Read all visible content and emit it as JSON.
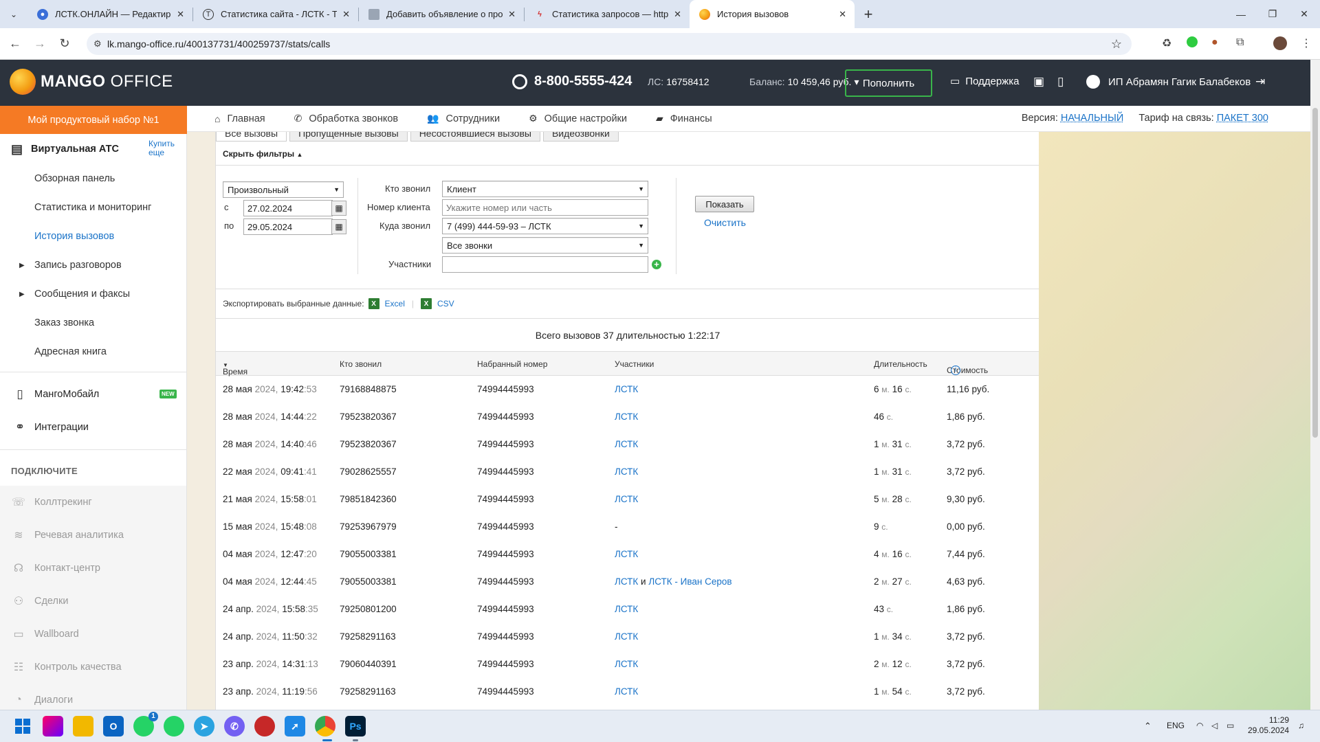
{
  "browser": {
    "tabs": [
      {
        "title": "ЛСТК.ОНЛАЙН — Редактиров",
        "icon": "chrome-profile-icon",
        "active": false
      },
      {
        "title": "Статистика сайта - ЛСТК - Tild",
        "icon": "tilda-icon",
        "active": false
      },
      {
        "title": "Добавить объявление о прод",
        "icon": "page-icon",
        "active": false
      },
      {
        "title": "Статистика запросов — https:",
        "icon": "wordstat-icon",
        "active": false
      },
      {
        "title": "История вызовов",
        "icon": "mango-icon",
        "active": true
      }
    ],
    "url": "lk.mango-office.ru/400137731/400259737/stats/calls"
  },
  "header": {
    "logo_bold": "MANGO",
    "logo_light": "OFFICE",
    "phone": "8-800-5555-424",
    "ls_label": "ЛС:",
    "ls_value": "16758412",
    "balance_label": "Баланс:",
    "balance_value": "10 459,46 руб.",
    "topup": "Пополнить",
    "support": "Поддержка",
    "user": "ИП Абрамян Гагик Балабеков"
  },
  "promo": "Мой продуктовый набор №1",
  "topnav": {
    "items": [
      "Главная",
      "Обработка звонков",
      "Сотрудники",
      "Общие настройки",
      "Финансы"
    ],
    "version_label": "Версия:",
    "version_value": "НАЧАЛЬНЫЙ",
    "tariff_label": "Тариф на связь:",
    "tariff_value": "ПАКЕТ 300"
  },
  "sidebar": {
    "vats": "Виртуальная АТС",
    "buy_line1": "Купить",
    "buy_line2": "еще",
    "items": [
      "Обзорная панель",
      "Статистика и мониторинг",
      "История вызовов",
      "Запись разговоров",
      "Сообщения и факсы",
      "Заказ звонка",
      "Адресная книга"
    ],
    "mobile": "МангоМобайл",
    "new_badge": "NEW",
    "integrations": "Интеграции",
    "connect": "ПОДКЛЮЧИТЕ",
    "products": [
      "Коллтрекинг",
      "Речевая аналитика",
      "Контакт-центр",
      "Сделки",
      "Wallboard",
      "Контроль качества",
      "Диалоги"
    ]
  },
  "content": {
    "tabs": [
      "Все вызовы",
      "Пропущенные вызовы",
      "Несостоявшиеся вызовы",
      "Видеозвонки"
    ],
    "hide_filters": "Скрыть фильтры",
    "filters": {
      "period": "Произвольный",
      "from_label": "с",
      "from": "27.02.2024",
      "to_label": "по",
      "to": "29.05.2024",
      "who_label": "Кто звонил",
      "who": "Клиент",
      "client_label": "Номер клиента",
      "client_placeholder": "Укажите номер или часть",
      "where_label": "Куда звонил",
      "where": "7 (499) 444-59-93 – ЛСТК",
      "calls": "Все звонки",
      "participants_label": "Участники",
      "show": "Показать",
      "clear": "Очистить"
    },
    "export_label": "Экспортировать выбранные данные:",
    "export_excel": "Excel",
    "export_csv": "CSV",
    "summary": "Всего вызовов 37 длительностью 1:22:17",
    "columns": {
      "time": "Время",
      "who": "Кто звонил",
      "dialed": "Набранный номер",
      "participants": "Участники",
      "duration": "Длительность",
      "cost": "Стоимость"
    },
    "rows": [
      {
        "date": "28 мая",
        "year": "2024,",
        "hm": "19:42",
        "sec": ":53",
        "who": "79168848875",
        "dialed": "74994445993",
        "p1": "ЛСТК",
        "and": "",
        "p2": "",
        "d1": "6",
        "u1": "м.",
        "d2": "16",
        "u2": "с.",
        "cost": "11,16 руб."
      },
      {
        "date": "28 мая",
        "year": "2024,",
        "hm": "14:44",
        "sec": ":22",
        "who": "79523820367",
        "dialed": "74994445993",
        "p1": "ЛСТК",
        "and": "",
        "p2": "",
        "d1": "46",
        "u1": "с.",
        "d2": "",
        "u2": "",
        "cost": "1,86 руб."
      },
      {
        "date": "28 мая",
        "year": "2024,",
        "hm": "14:40",
        "sec": ":46",
        "who": "79523820367",
        "dialed": "74994445993",
        "p1": "ЛСТК",
        "and": "",
        "p2": "",
        "d1": "1",
        "u1": "м.",
        "d2": "31",
        "u2": "с.",
        "cost": "3,72 руб."
      },
      {
        "date": "22 мая",
        "year": "2024,",
        "hm": "09:41",
        "sec": ":41",
        "who": "79028625557",
        "dialed": "74994445993",
        "p1": "ЛСТК",
        "and": "",
        "p2": "",
        "d1": "1",
        "u1": "м.",
        "d2": "31",
        "u2": "с.",
        "cost": "3,72 руб."
      },
      {
        "date": "21 мая",
        "year": "2024,",
        "hm": "15:58",
        "sec": ":01",
        "who": "79851842360",
        "dialed": "74994445993",
        "p1": "ЛСТК",
        "and": "",
        "p2": "",
        "d1": "5",
        "u1": "м.",
        "d2": "28",
        "u2": "с.",
        "cost": "9,30 руб."
      },
      {
        "date": "15 мая",
        "year": "2024,",
        "hm": "15:48",
        "sec": ":08",
        "who": "79253967979",
        "dialed": "74994445993",
        "p1": "",
        "dash": "-",
        "and": "",
        "p2": "",
        "d1": "9",
        "u1": "с.",
        "d2": "",
        "u2": "",
        "cost": "0,00 руб."
      },
      {
        "date": "04 мая",
        "year": "2024,",
        "hm": "12:47",
        "sec": ":20",
        "who": "79055003381",
        "dialed": "74994445993",
        "p1": "ЛСТК",
        "and": "",
        "p2": "",
        "d1": "4",
        "u1": "м.",
        "d2": "16",
        "u2": "с.",
        "cost": "7,44 руб."
      },
      {
        "date": "04 мая",
        "year": "2024,",
        "hm": "12:44",
        "sec": ":45",
        "who": "79055003381",
        "dialed": "74994445993",
        "p1": "ЛСТК",
        "and": "и",
        "p2": "ЛСТК - Иван Серов",
        "d1": "2",
        "u1": "м.",
        "d2": "27",
        "u2": "с.",
        "cost": "4,63 руб."
      },
      {
        "date": "24 апр.",
        "year": "2024,",
        "hm": "15:58",
        "sec": ":35",
        "who": "79250801200",
        "dialed": "74994445993",
        "p1": "ЛСТК",
        "and": "",
        "p2": "",
        "d1": "43",
        "u1": "с.",
        "d2": "",
        "u2": "",
        "cost": "1,86 руб."
      },
      {
        "date": "24 апр.",
        "year": "2024,",
        "hm": "11:50",
        "sec": ":32",
        "who": "79258291163",
        "dialed": "74994445993",
        "p1": "ЛСТК",
        "and": "",
        "p2": "",
        "d1": "1",
        "u1": "м.",
        "d2": "34",
        "u2": "с.",
        "cost": "3,72 руб."
      },
      {
        "date": "23 апр.",
        "year": "2024,",
        "hm": "14:31",
        "sec": ":13",
        "who": "79060440391",
        "dialed": "74994445993",
        "p1": "ЛСТК",
        "and": "",
        "p2": "",
        "d1": "2",
        "u1": "м.",
        "d2": "12",
        "u2": "с.",
        "cost": "3,72 руб."
      },
      {
        "date": "23 апр.",
        "year": "2024,",
        "hm": "11:19",
        "sec": ":56",
        "who": "79258291163",
        "dialed": "74994445993",
        "p1": "ЛСТК",
        "and": "",
        "p2": "",
        "d1": "1",
        "u1": "м.",
        "d2": "54",
        "u2": "с.",
        "cost": "3,72 руб."
      }
    ]
  },
  "taskbar": {
    "lang": "ENG",
    "time": "11:29",
    "date": "29.05.2024",
    "whatsapp_badge": "1"
  },
  "colors": {
    "header_bg": "#2c333d",
    "promo": "#f57a24",
    "accent_green": "#39b54a",
    "link": "#1a73c8"
  }
}
